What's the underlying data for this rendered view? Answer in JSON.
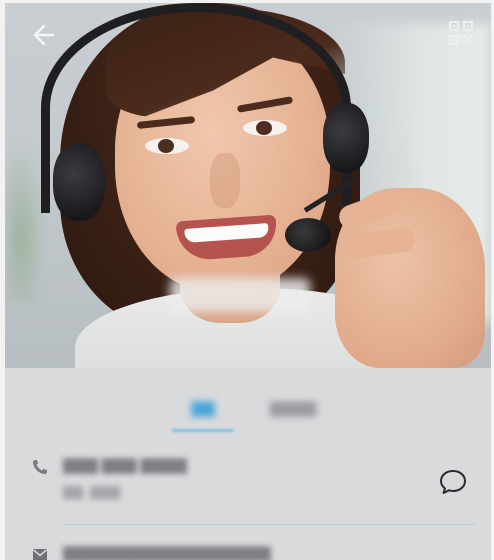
{
  "header": {
    "back_icon": "back-arrow-icon",
    "qr_icon": "qr-code-icon"
  },
  "profile": {
    "name": "▇▇▇ ▇▇▇"
  },
  "tabs": [
    {
      "label": "▇▇",
      "active": true
    },
    {
      "label": "▇▇▇▇",
      "active": false
    }
  ],
  "contact": {
    "phone": {
      "icon": "phone-icon",
      "number": "▇▇▇ ▇▇▇ ▇▇▇▇",
      "label": "▇▇, ▇▇▇",
      "action_icon": "message-bubble-icon"
    },
    "email": {
      "icon": "mail-icon",
      "address": "▇▇▇▇▇▇▇▇▇▇▇▇▇▇▇▇▇▇",
      "action_icon": "chevron-icon"
    }
  },
  "colors": {
    "accent": "#49a6d9",
    "overlay": "#d9dadc",
    "divider": "#b9cfd6"
  }
}
